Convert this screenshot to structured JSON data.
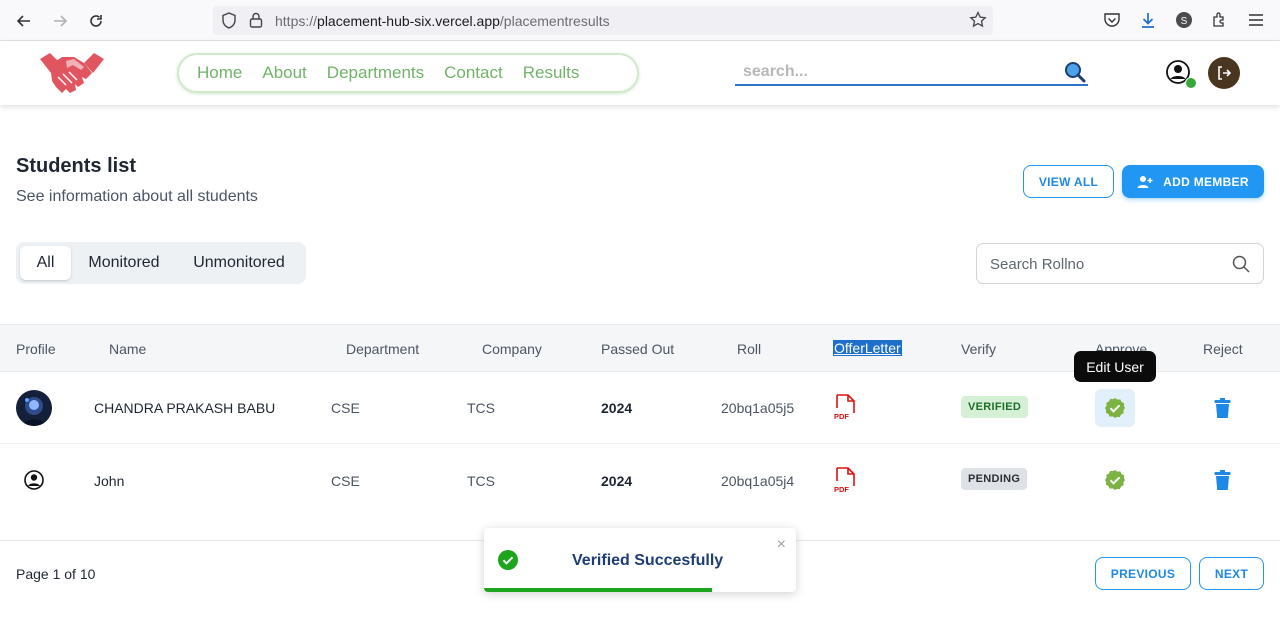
{
  "browser": {
    "url_prefix": "https://",
    "url_host": "placement-hub-six.vercel.app",
    "url_path": "/placementresults"
  },
  "header": {
    "nav": [
      "Home",
      "About",
      "Departments",
      "Contact",
      "Results"
    ],
    "search_placeholder": "search..."
  },
  "page": {
    "title": "Students list",
    "subtitle": "See information about all students",
    "view_all_label": "VIEW ALL",
    "add_member_label": "ADD MEMBER"
  },
  "tabs": {
    "items": [
      "All",
      "Monitored",
      "Unmonitored"
    ],
    "active": "All"
  },
  "roll_search": {
    "placeholder": "Search Rollno"
  },
  "table": {
    "columns": [
      "Profile",
      "Name",
      "Department",
      "Company",
      "Passed Out",
      "Roll",
      "OfferLetter",
      "Verify",
      "Approve",
      "Reject"
    ],
    "rows": [
      {
        "name": "CHANDRA PRAKASH BABU",
        "department": "CSE",
        "company": "TCS",
        "passed_out": "2024",
        "roll": "20bq1a05j5",
        "offer_icon_text": "PDF",
        "status": "VERIFIED"
      },
      {
        "name": "John",
        "department": "CSE",
        "company": "TCS",
        "passed_out": "2024",
        "roll": "20bq1a05j4",
        "offer_icon_text": "PDF",
        "status": "PENDING"
      }
    ],
    "tooltip": "Edit User"
  },
  "pagination": {
    "info": "Page 1 of 10",
    "previous_label": "PREVIOUS",
    "next_label": "NEXT"
  },
  "toast": {
    "message": "Verified Succesfully",
    "close_symbol": "×",
    "progress": 0.73
  },
  "colors": {
    "accent": "#2196f3",
    "nav_green": "#72b36a",
    "logo_red": "#e05560",
    "success": "#38a838",
    "danger_blue": "#1e88e5"
  }
}
